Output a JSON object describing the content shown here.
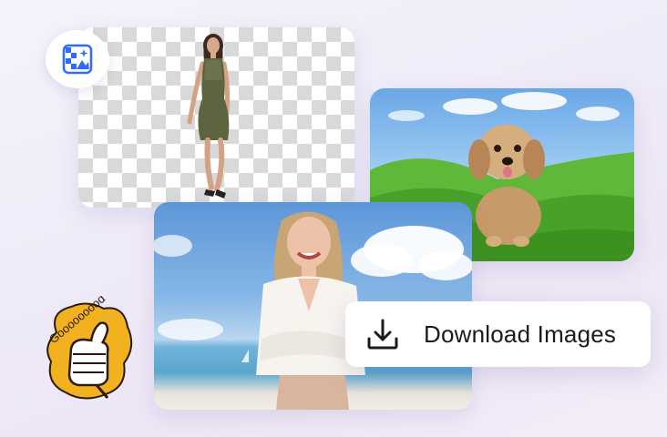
{
  "badge": {
    "icon": "magic-image-icon"
  },
  "cards": {
    "dress": {
      "image": "woman-in-olive-dress-transparent-background"
    },
    "dog": {
      "image": "fluffy-puppy-on-green-hills"
    },
    "beach": {
      "image": "laughing-woman-at-beach"
    }
  },
  "download": {
    "label": "Download Images",
    "icon": "download-icon"
  },
  "sticker": {
    "text": "Gooooooood",
    "icon": "thumbs-up-icon"
  },
  "colors": {
    "accent_blue": "#2f6bff",
    "grass": "#4caf2c",
    "sticker_yellow": "#f2b21f",
    "pill_text": "#1a1a1f"
  }
}
